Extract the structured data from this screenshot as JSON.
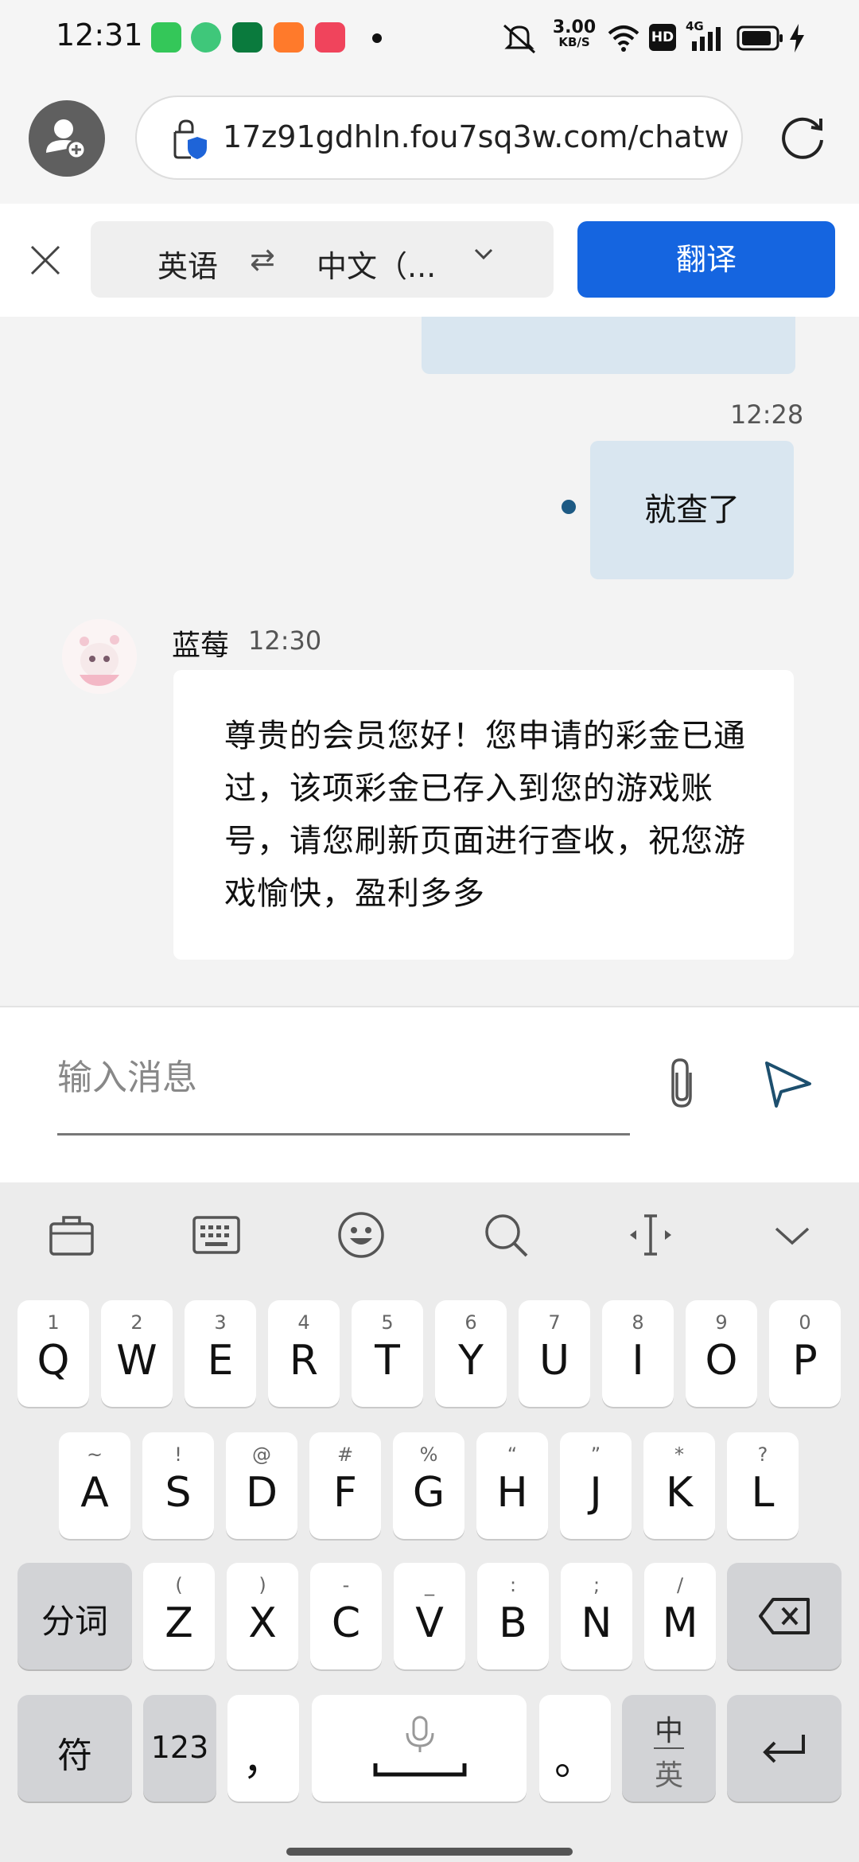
{
  "status_bar": {
    "time": "12:31",
    "network_speed_value": "3.00",
    "network_speed_unit": "KB/S",
    "hd_badge": "HD",
    "signal_label": "4G",
    "icons": [
      "app-store-icon",
      "pdp-icon",
      "oppo-icon",
      "game-app-icon",
      "music-app-icon",
      "notification-dot-icon",
      "mute-icon",
      "wifi-icon",
      "signal-icon",
      "battery-icon",
      "charging-icon"
    ]
  },
  "browser": {
    "url": "17z91gdhln.fou7sq3w.com/chatw",
    "icons": [
      "user-add-icon",
      "secure-shield-icon",
      "reload-icon"
    ]
  },
  "translate_bar": {
    "source_lang": "英语",
    "swap_symbol": "⇄",
    "target_lang": "中文（...",
    "translate_label": "翻译"
  },
  "chat": {
    "outgoing_time": "12:28",
    "outgoing_text": "就查了",
    "incoming_sender": "蓝莓",
    "incoming_time": "12:30",
    "incoming_text": "尊贵的会员您好！您申请的彩金已通过，该项彩金已存入到您的游戏账号，请您刷新页面进行查收，祝您游戏愉快，盈利多多",
    "colors": {
      "outgoing_bubble": "#d9e6f0",
      "incoming_bubble": "#ffffff",
      "read_dot": "#1d5a84"
    }
  },
  "composer": {
    "placeholder": "输入消息",
    "icons": [
      "paperclip-icon",
      "send-icon"
    ]
  },
  "keyboard": {
    "toolbar_icons": [
      "briefcase-icon",
      "keyboard-icon",
      "emoji-icon",
      "search-icon",
      "cursor-icon",
      "collapse-icon"
    ],
    "row1": [
      {
        "main": "Q",
        "sub": "1"
      },
      {
        "main": "W",
        "sub": "2"
      },
      {
        "main": "E",
        "sub": "3"
      },
      {
        "main": "R",
        "sub": "4"
      },
      {
        "main": "T",
        "sub": "5"
      },
      {
        "main": "Y",
        "sub": "6"
      },
      {
        "main": "U",
        "sub": "7"
      },
      {
        "main": "I",
        "sub": "8"
      },
      {
        "main": "O",
        "sub": "9"
      },
      {
        "main": "P",
        "sub": "0"
      }
    ],
    "row2": [
      {
        "main": "A",
        "sub": "~"
      },
      {
        "main": "S",
        "sub": "!"
      },
      {
        "main": "D",
        "sub": "@"
      },
      {
        "main": "F",
        "sub": "#"
      },
      {
        "main": "G",
        "sub": "%"
      },
      {
        "main": "H",
        "sub": "“"
      },
      {
        "main": "J",
        "sub": "”"
      },
      {
        "main": "K",
        "sub": "*"
      },
      {
        "main": "L",
        "sub": "?"
      }
    ],
    "row3": [
      {
        "main": "Z",
        "sub": "("
      },
      {
        "main": "X",
        "sub": ")"
      },
      {
        "main": "C",
        "sub": "-"
      },
      {
        "main": "V",
        "sub": "_"
      },
      {
        "main": "B",
        "sub": ":"
      },
      {
        "main": "N",
        "sub": ";"
      },
      {
        "main": "M",
        "sub": "/"
      }
    ],
    "segment_label": "分词",
    "symbol_label": "符",
    "num_label": "123",
    "comma_label": "，",
    "period_label": "。",
    "lang_switch_top": "中",
    "lang_switch_bottom": "英"
  }
}
